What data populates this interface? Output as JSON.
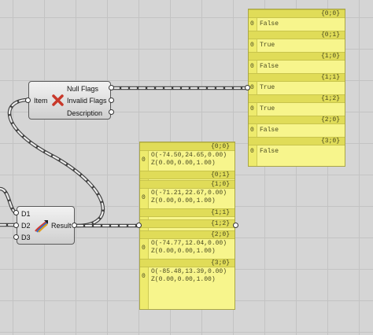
{
  "canvas": {
    "bg": "#d5d5d5",
    "grid": "#c3c3c3",
    "wire": "#3f3f3f"
  },
  "null_check": {
    "input_label": "Item",
    "icon": "red-x-icon",
    "outputs": [
      "Null Flags",
      "Invalid Flags",
      "Description"
    ]
  },
  "flags_panel": {
    "rows": [
      {
        "path": "{0;0}",
        "index": "0",
        "value": "False"
      },
      {
        "path": "{0;1}",
        "index": "0",
        "value": "True"
      },
      {
        "path": "{1;0}",
        "index": "0",
        "value": "False"
      },
      {
        "path": "{1;1}",
        "index": "0",
        "value": "True"
      },
      {
        "path": "{1;2}",
        "index": "0",
        "value": "True"
      },
      {
        "path": "{2;0}",
        "index": "0",
        "value": "False"
      },
      {
        "path": "{3;0}",
        "index": "0",
        "value": "False"
      }
    ]
  },
  "merge": {
    "inputs": [
      "D1",
      "D2",
      "D3"
    ],
    "icon": "merge-arrows-icon",
    "output_label": "Result"
  },
  "planes_panel": {
    "rows": [
      {
        "path": "{0;0}",
        "index": "0",
        "lines": [
          "O(-74.50,24.65,0.00)",
          "Z(0.00,0.00,1.00)"
        ]
      },
      {
        "path": "{0;1}",
        "index": "",
        "lines": []
      },
      {
        "path": "{1;0}",
        "index": "0",
        "lines": [
          "O(-71.21,22.67,0.00)",
          "Z(0.00,0.00,1.00)"
        ]
      },
      {
        "path": "{1;1}",
        "index": "",
        "lines": []
      },
      {
        "path": "{1;2}",
        "index": "",
        "lines": []
      },
      {
        "path": "{2;0}",
        "index": "0",
        "lines": [
          "O(-74.77,12.04,0.00)",
          "Z(0.00,0.00,1.00)"
        ]
      },
      {
        "path": "{3;0}",
        "index": "0",
        "lines": [
          "O(-85.48,13.39,0.00)",
          "Z(0.00,0.00,1.00)"
        ]
      }
    ]
  }
}
